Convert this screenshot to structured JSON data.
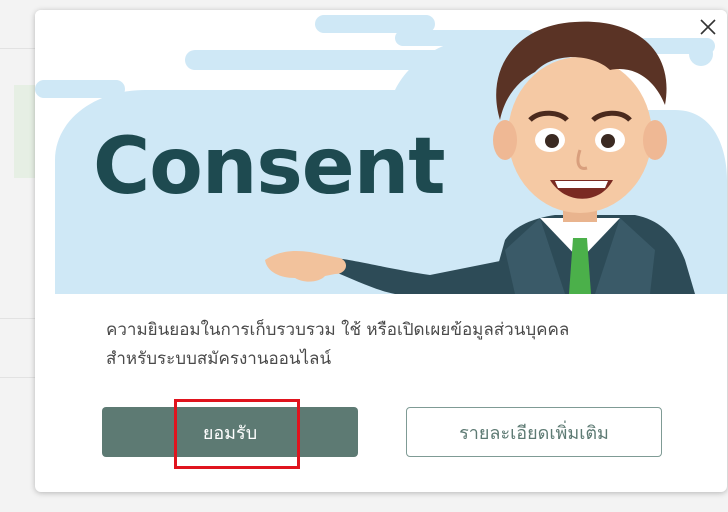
{
  "modal": {
    "hero_title": "Consent",
    "message_line1": "ความยินยอมในการเก็บรวบรวม ใช้ หรือเปิดเผยข้อมูลส่วนบุคคล",
    "message_line2": "สำหรับระบบสมัครงานออนไลน์",
    "accept_label": "ยอมรับ",
    "more_label": "รายละเอียดเพิ่มเติม",
    "close_icon": "close-icon",
    "illustration": "businessman-presenting-illustration"
  },
  "colors": {
    "accent": "#5d7a73",
    "title": "#1e4a50",
    "highlight": "#e0141e",
    "cloud": "#cfe8f6"
  }
}
